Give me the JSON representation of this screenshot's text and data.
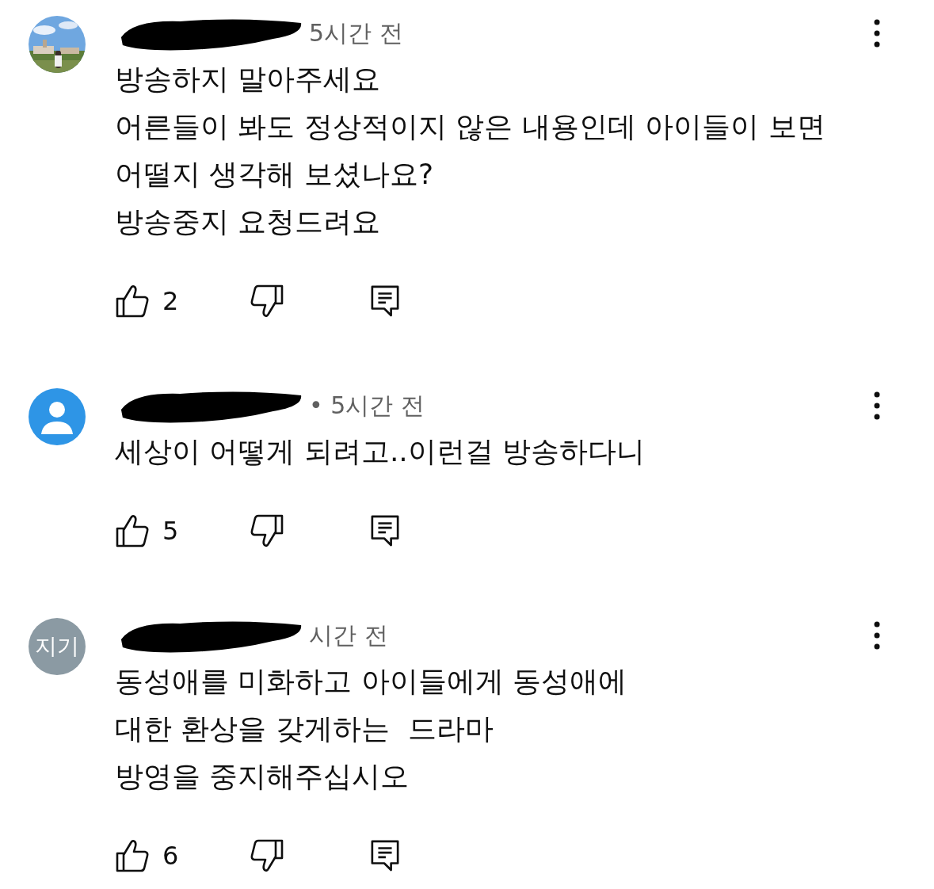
{
  "comments": [
    {
      "meta": "5시간 전",
      "lines": [
        "방송하지 말아주세요",
        "어른들이 봐도 정상적이지 않은 내용인데 아이들이 보면",
        "어떨지 생각해 보셨나요?",
        "방송중지 요청드려요"
      ],
      "likes": "2"
    },
    {
      "avatar": {
        "kind": "silhouette"
      },
      "meta": "• 5시간 전",
      "lines": [
        "세상이 어떻게 되려고..이런걸 방송하다니"
      ],
      "likes": "5"
    },
    {
      "avatar": {
        "kind": "initials",
        "text": "지기"
      },
      "meta": "시간 전",
      "lines": [
        "동성애를 미화하고 아이들에게 동성애에",
        "대한 환상을 갖게하는  드라마",
        "방영을 중지해주십시오"
      ],
      "likes": "6"
    }
  ]
}
